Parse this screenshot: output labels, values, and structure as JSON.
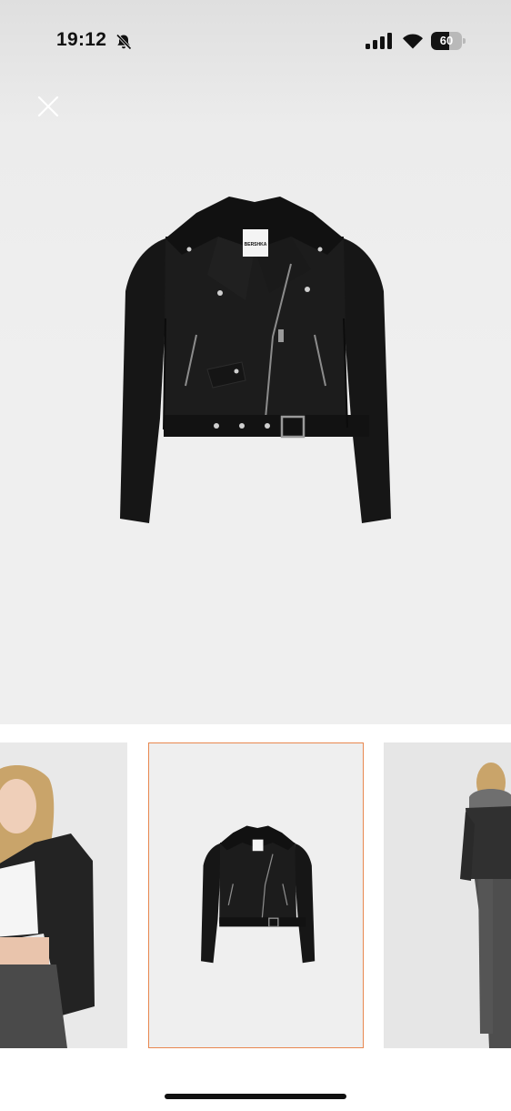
{
  "status_bar": {
    "time": "19:12",
    "battery_level": "60",
    "icons": [
      "bell-slash-icon",
      "cellular-signal-icon",
      "wifi-icon",
      "battery-icon"
    ]
  },
  "viewer": {
    "close_icon": "close-icon",
    "main_image": "black-cropped-biker-jacket",
    "brand_label": "BERSHKA"
  },
  "gallery": {
    "selected_index": 1,
    "accent_color": "#e8874f",
    "thumbnails": [
      {
        "image": "model-front-wearing-jacket"
      },
      {
        "image": "jacket-product-shot"
      },
      {
        "image": "model-back-wearing-jacket"
      }
    ]
  }
}
